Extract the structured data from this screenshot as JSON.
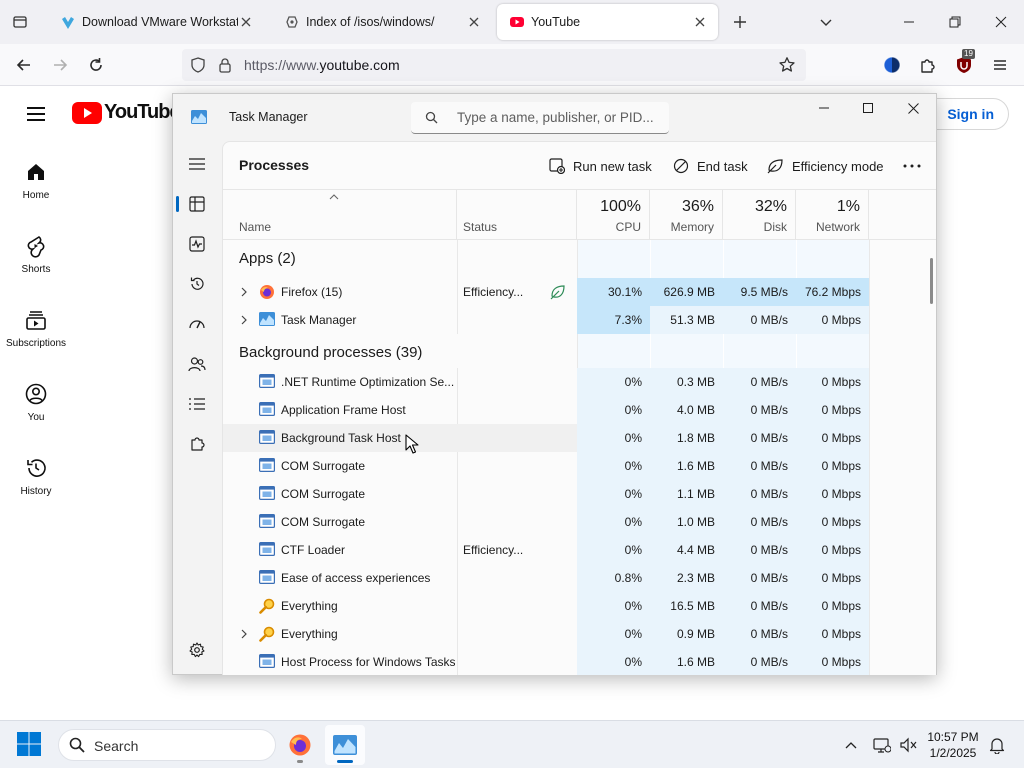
{
  "browser": {
    "tabs": [
      {
        "title": "Download VMware Workstation",
        "active": false
      },
      {
        "title": "Index of /isos/windows/",
        "active": false
      },
      {
        "title": "YouTube",
        "active": true
      }
    ],
    "url_prefix": "https://www.",
    "url_domain": "youtube.com",
    "extension_badge": "19"
  },
  "youtube": {
    "logo_text": "YouTube",
    "sidebar": [
      {
        "label": "Home",
        "icon": "home-icon"
      },
      {
        "label": "Shorts",
        "icon": "shorts-icon"
      },
      {
        "label": "Subscriptions",
        "icon": "subscriptions-icon"
      },
      {
        "label": "You",
        "icon": "you-icon"
      },
      {
        "label": "History",
        "icon": "history-icon"
      }
    ],
    "signin_label": "Sign in"
  },
  "task_manager": {
    "title": "Task Manager",
    "search_placeholder": "Type a name, publisher, or PID...",
    "page_title": "Processes",
    "commands": {
      "run_new_task": "Run new task",
      "end_task": "End task",
      "efficiency_mode": "Efficiency mode"
    },
    "columns": {
      "name": "Name",
      "status": "Status",
      "cpu": {
        "pct": "100%",
        "label": "CPU"
      },
      "memory": {
        "pct": "36%",
        "label": "Memory"
      },
      "disk": {
        "pct": "32%",
        "label": "Disk"
      },
      "network": {
        "pct": "1%",
        "label": "Network"
      }
    },
    "groups": {
      "apps": "Apps (2)",
      "background": "Background processes (39)"
    },
    "apps": [
      {
        "name": "Firefox (15)",
        "status": "Efficiency...",
        "cpu": "30.1%",
        "memory": "626.9 MB",
        "disk": "9.5 MB/s",
        "network": "76.2 Mbps",
        "icon": "firefox-icon",
        "expandable": true,
        "efficiency_leaf": true
      },
      {
        "name": "Task Manager",
        "status": "",
        "cpu": "7.3%",
        "memory": "51.3 MB",
        "disk": "0 MB/s",
        "network": "0 Mbps",
        "icon": "task-manager-icon",
        "expandable": true,
        "efficiency_leaf": false
      }
    ],
    "background": [
      {
        "name": ".NET Runtime Optimization Se...",
        "status": "",
        "cpu": "0%",
        "memory": "0.3 MB",
        "disk": "0 MB/s",
        "network": "0 Mbps",
        "icon": "window-app-icon",
        "expandable": false
      },
      {
        "name": "Application Frame Host",
        "status": "",
        "cpu": "0%",
        "memory": "4.0 MB",
        "disk": "0 MB/s",
        "network": "0 Mbps",
        "icon": "window-app-icon",
        "expandable": false
      },
      {
        "name": "Background Task Host",
        "status": "",
        "cpu": "0%",
        "memory": "1.8 MB",
        "disk": "0 MB/s",
        "network": "0 Mbps",
        "icon": "window-app-icon",
        "expandable": false
      },
      {
        "name": "COM Surrogate",
        "status": "",
        "cpu": "0%",
        "memory": "1.6 MB",
        "disk": "0 MB/s",
        "network": "0 Mbps",
        "icon": "window-app-icon",
        "expandable": false
      },
      {
        "name": "COM Surrogate",
        "status": "",
        "cpu": "0%",
        "memory": "1.1 MB",
        "disk": "0 MB/s",
        "network": "0 Mbps",
        "icon": "window-app-icon",
        "expandable": false
      },
      {
        "name": "COM Surrogate",
        "status": "",
        "cpu": "0%",
        "memory": "1.0 MB",
        "disk": "0 MB/s",
        "network": "0 Mbps",
        "icon": "window-app-icon",
        "expandable": false
      },
      {
        "name": "CTF Loader",
        "status": "Efficiency...",
        "cpu": "0%",
        "memory": "4.4 MB",
        "disk": "0 MB/s",
        "network": "0 Mbps",
        "icon": "window-app-icon",
        "expandable": false
      },
      {
        "name": "Ease of access experiences",
        "status": "",
        "cpu": "0.8%",
        "memory": "2.3 MB",
        "disk": "0 MB/s",
        "network": "0 Mbps",
        "icon": "window-app-icon",
        "expandable": false
      },
      {
        "name": "Everything",
        "status": "",
        "cpu": "0%",
        "memory": "16.5 MB",
        "disk": "0 MB/s",
        "network": "0 Mbps",
        "icon": "everything-search-icon",
        "expandable": false
      },
      {
        "name": "Everything",
        "status": "",
        "cpu": "0%",
        "memory": "0.9 MB",
        "disk": "0 MB/s",
        "network": "0 Mbps",
        "icon": "everything-search-icon",
        "expandable": true
      },
      {
        "name": "Host Process for Windows Tasks",
        "status": "",
        "cpu": "0%",
        "memory": "1.6 MB",
        "disk": "0 MB/s",
        "network": "0 Mbps",
        "icon": "window-app-icon",
        "expandable": false
      }
    ]
  },
  "taskbar": {
    "search_label": "Search",
    "time": "10:57 PM",
    "date": "1/2/2025"
  },
  "colors": {
    "yt_red": "#ff0000",
    "metric_light": "#e9f4fc",
    "metric_high": "#c6e6fa",
    "accent": "#0067c0"
  }
}
